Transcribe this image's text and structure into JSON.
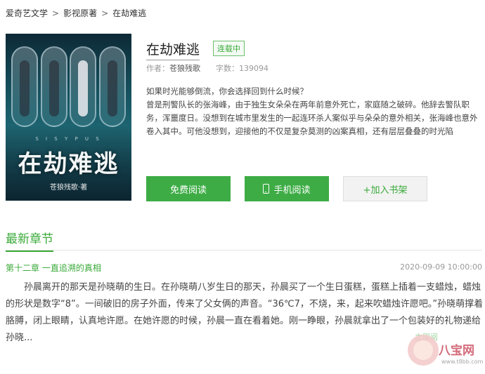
{
  "breadcrumb": {
    "items": [
      "爱奇艺文学",
      "影视原著",
      "在劫难逃"
    ],
    "separator": ">"
  },
  "cover": {
    "series_text": "S I S Y P U S",
    "title": "在劫难逃",
    "author": "苍狼残歌·著"
  },
  "book": {
    "title": "在劫难逃",
    "status": "连载中",
    "author_label": "作者：",
    "author": "苍狼残歌",
    "wordcount": "字数：139094"
  },
  "summary": {
    "line1": "如果时光能够倒流，你会选择回到什么时候？",
    "line2": "曾是刑警队长的张海峰，由于独生女朵朵在两年前意外死亡，家庭随之破碎。他辞去警队职务，浑噩度日。没想到在城市里发生的一起连环杀人案似乎与朵朵的意外相关，张海峰也意外卷入其中。可他没想到，迎接他的不仅是复杂莫测的凶案真相，还有层层叠叠的时光陷"
  },
  "actions": {
    "read": "免费阅读",
    "mobile": "手机阅读",
    "shelf": "+加入书架"
  },
  "latest": {
    "heading": "最新章节",
    "chapter_title": "第十二章 一直追溯的真相",
    "date": "2020-09-09 10:00:00",
    "excerpt": "孙晨离开的那天是孙晓萌的生日。在孙晓萌八岁生日的那天，孙晨买了一个生日蛋糕，蛋糕上插着一支蜡烛，蜡烛的形状是数字“8”。一间破旧的房子外面，传来了父女俩的声音。“36℃7，不烧，来，起来吹蜡烛许愿吧。”孙晓萌撑着胳膊，闭上眼睛，认真地许愿。在她许愿的时候，孙晨一直在看着她。刚一睁眼，孙晨就拿出了一个包装好的礼物递给孙晓..."
  },
  "watermark": {
    "brand": "八宝网",
    "site": "www.t8bb.com",
    "ghost": "立即阅"
  }
}
